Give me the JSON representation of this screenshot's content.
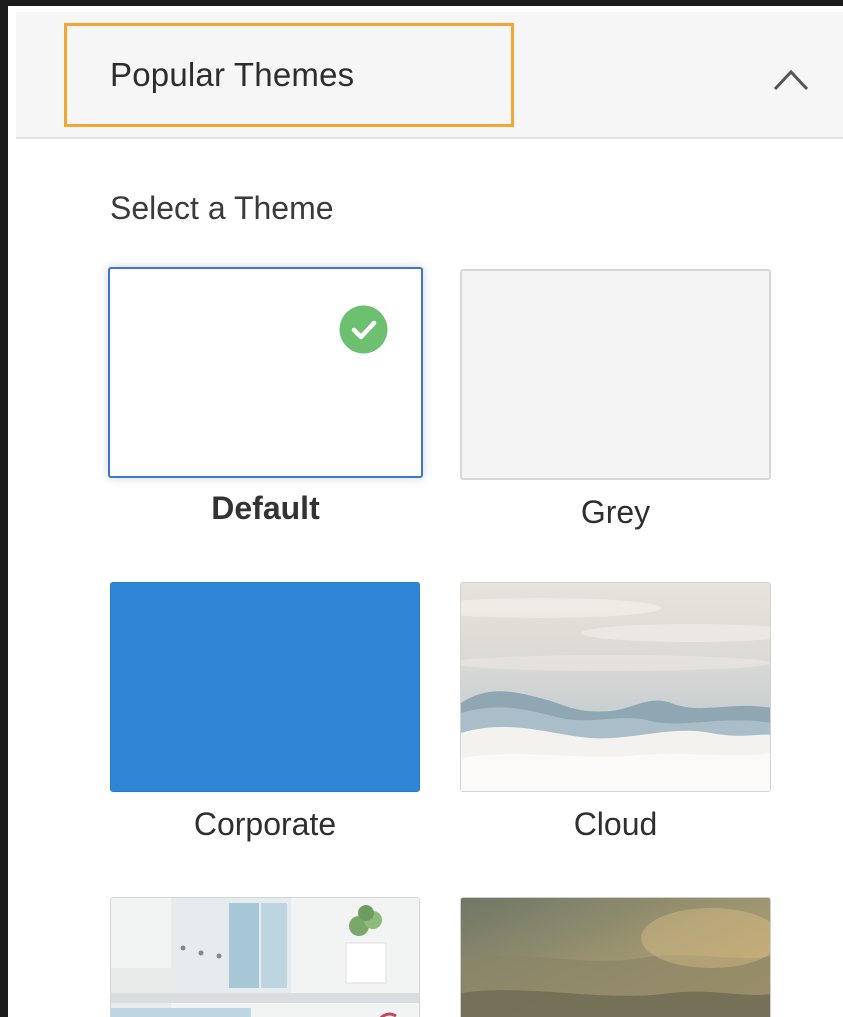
{
  "header": {
    "title": "Popular Themes",
    "collapse_icon": "chevron-up-icon",
    "highlight_color": "#f5a631"
  },
  "section": {
    "label": "Select a Theme"
  },
  "themes": [
    {
      "label": "Default",
      "selected": true,
      "color": "#ffffff"
    },
    {
      "label": "Grey",
      "selected": false,
      "color": "#f4f4f4"
    },
    {
      "label": "Corporate",
      "selected": false,
      "color": "#2f86d6"
    },
    {
      "label": "Cloud",
      "selected": false,
      "image": "clouds"
    },
    {
      "label": "",
      "selected": false,
      "image": "office-desk"
    },
    {
      "label": "",
      "selected": false,
      "image": "landscape"
    }
  ],
  "colors": {
    "selected_border": "#3b78c9",
    "check_badge": "#6cc070"
  }
}
